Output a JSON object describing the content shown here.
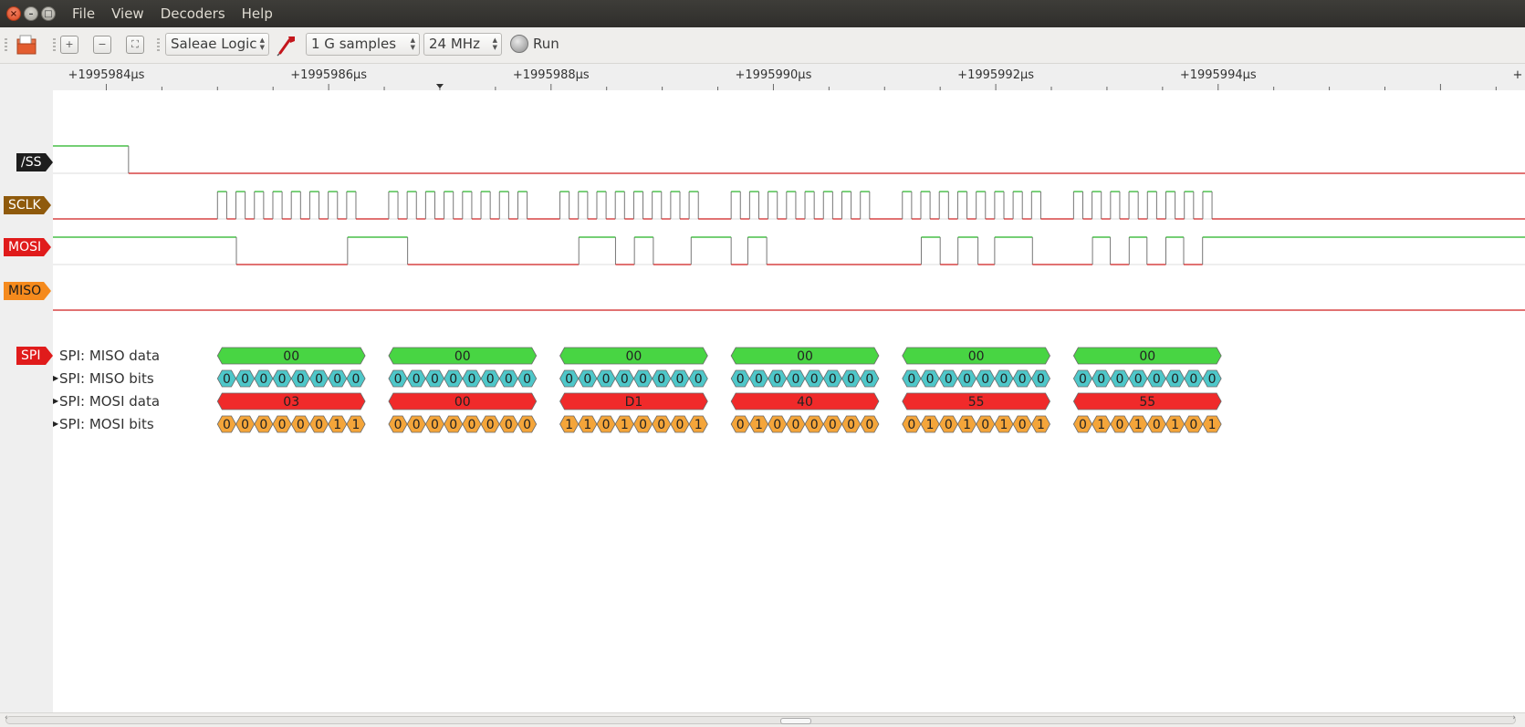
{
  "window": {
    "close_icon": "close-icon",
    "minimize_icon": "minimize-icon",
    "maximize_icon": "maximize-icon"
  },
  "menu": [
    "File",
    "View",
    "Decoders",
    "Help"
  ],
  "toolbar": {
    "device": "Saleae Logic",
    "samples": "1 G samples",
    "samplerate": "24 MHz",
    "run_label": "Run",
    "icons": [
      "open-file-icon",
      "add-channel-icon",
      "remove-channel-icon",
      "zoom-fit-icon",
      "probe-config-icon",
      "run-indicator-icon"
    ]
  },
  "ruler": {
    "labels": [
      "+1995984µs",
      "+1995986µs",
      "+1995988µs",
      "+1995990µs",
      "+1995992µs",
      "+1995994µs",
      "+"
    ],
    "time_start_us": 1995983.52,
    "time_end_us": 1995996.76,
    "major_step_us": 2,
    "minor_step_us": 0.5,
    "cursor_us": 1995987.0
  },
  "channels": [
    {
      "label": "/SS",
      "bg": "#1d1d1d",
      "fg": "#ffffff"
    },
    {
      "label": "SCLK",
      "bg": "#8f5a0c",
      "fg": "#ffffff"
    },
    {
      "label": "MOSI",
      "bg": "#e01b1b",
      "fg": "#ffffff"
    },
    {
      "label": "MISO",
      "bg": "#f58a1d",
      "fg": "#1d1d1d"
    }
  ],
  "signals": {
    "ss": {
      "initial": 1,
      "toggles_us": [
        1995984.2
      ]
    },
    "sclk": {
      "initial": 0,
      "byte_starts_us": [
        1995985.0,
        1995986.54,
        1995988.08,
        1995989.62,
        1995991.16,
        1995992.7
      ],
      "period_us": 0.166,
      "high_us": 0.083
    },
    "mosi": {
      "initial": 1,
      "toggles_us": [
        1995985.17,
        1995986.17,
        1995986.71,
        1995988.25,
        1995988.58,
        1995988.75,
        1995988.92,
        1995989.26,
        1995989.62,
        1995989.77,
        1995989.94,
        1995991.33,
        1995991.5,
        1995991.66,
        1995991.84,
        1995991.99,
        1995992.33,
        1995992.87,
        1995993.03,
        1995993.2,
        1995993.36,
        1995993.53,
        1995993.69,
        1995993.86
      ]
    },
    "miso": {
      "initial": 0,
      "toggles_us": []
    }
  },
  "decoder": {
    "label": "SPI",
    "bg": "#e01b1b",
    "rows": [
      {
        "name": "SPI: MISO data",
        "expander": false
      },
      {
        "name": "SPI: MISO bits",
        "expander": true
      },
      {
        "name": "SPI: MOSI data",
        "expander": true
      },
      {
        "name": "SPI: MOSI bits",
        "expander": true
      }
    ],
    "colors": {
      "miso_data": "#48d543",
      "miso_bits": "#4ec7c9",
      "mosi_data": "#f02a2a",
      "mosi_bits": "#f4a53a"
    },
    "bytes": [
      {
        "miso": "00",
        "miso_bits": "00000000",
        "mosi": "03",
        "mosi_bits": "00000011"
      },
      {
        "miso": "00",
        "miso_bits": "00000000",
        "mosi": "00",
        "mosi_bits": "00000000"
      },
      {
        "miso": "00",
        "miso_bits": "00000000",
        "mosi": "D1",
        "mosi_bits": "11010001"
      },
      {
        "miso": "00",
        "miso_bits": "00000000",
        "mosi": "40",
        "mosi_bits": "01000000"
      },
      {
        "miso": "00",
        "miso_bits": "00000000",
        "mosi": "55",
        "mosi_bits": "01010101"
      },
      {
        "miso": "00",
        "miso_bits": "00000000",
        "mosi": "55",
        "mosi_bits": "01010101"
      }
    ]
  }
}
